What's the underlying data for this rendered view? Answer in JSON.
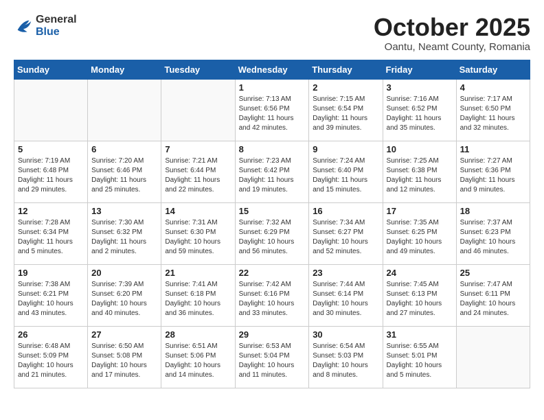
{
  "header": {
    "logo_general": "General",
    "logo_blue": "Blue",
    "month": "October 2025",
    "location": "Oantu, Neamt County, Romania"
  },
  "days_of_week": [
    "Sunday",
    "Monday",
    "Tuesday",
    "Wednesday",
    "Thursday",
    "Friday",
    "Saturday"
  ],
  "weeks": [
    [
      {
        "num": "",
        "info": ""
      },
      {
        "num": "",
        "info": ""
      },
      {
        "num": "",
        "info": ""
      },
      {
        "num": "1",
        "info": "Sunrise: 7:13 AM\nSunset: 6:56 PM\nDaylight: 11 hours\nand 42 minutes."
      },
      {
        "num": "2",
        "info": "Sunrise: 7:15 AM\nSunset: 6:54 PM\nDaylight: 11 hours\nand 39 minutes."
      },
      {
        "num": "3",
        "info": "Sunrise: 7:16 AM\nSunset: 6:52 PM\nDaylight: 11 hours\nand 35 minutes."
      },
      {
        "num": "4",
        "info": "Sunrise: 7:17 AM\nSunset: 6:50 PM\nDaylight: 11 hours\nand 32 minutes."
      }
    ],
    [
      {
        "num": "5",
        "info": "Sunrise: 7:19 AM\nSunset: 6:48 PM\nDaylight: 11 hours\nand 29 minutes."
      },
      {
        "num": "6",
        "info": "Sunrise: 7:20 AM\nSunset: 6:46 PM\nDaylight: 11 hours\nand 25 minutes."
      },
      {
        "num": "7",
        "info": "Sunrise: 7:21 AM\nSunset: 6:44 PM\nDaylight: 11 hours\nand 22 minutes."
      },
      {
        "num": "8",
        "info": "Sunrise: 7:23 AM\nSunset: 6:42 PM\nDaylight: 11 hours\nand 19 minutes."
      },
      {
        "num": "9",
        "info": "Sunrise: 7:24 AM\nSunset: 6:40 PM\nDaylight: 11 hours\nand 15 minutes."
      },
      {
        "num": "10",
        "info": "Sunrise: 7:25 AM\nSunset: 6:38 PM\nDaylight: 11 hours\nand 12 minutes."
      },
      {
        "num": "11",
        "info": "Sunrise: 7:27 AM\nSunset: 6:36 PM\nDaylight: 11 hours\nand 9 minutes."
      }
    ],
    [
      {
        "num": "12",
        "info": "Sunrise: 7:28 AM\nSunset: 6:34 PM\nDaylight: 11 hours\nand 5 minutes."
      },
      {
        "num": "13",
        "info": "Sunrise: 7:30 AM\nSunset: 6:32 PM\nDaylight: 11 hours\nand 2 minutes."
      },
      {
        "num": "14",
        "info": "Sunrise: 7:31 AM\nSunset: 6:30 PM\nDaylight: 10 hours\nand 59 minutes."
      },
      {
        "num": "15",
        "info": "Sunrise: 7:32 AM\nSunset: 6:29 PM\nDaylight: 10 hours\nand 56 minutes."
      },
      {
        "num": "16",
        "info": "Sunrise: 7:34 AM\nSunset: 6:27 PM\nDaylight: 10 hours\nand 52 minutes."
      },
      {
        "num": "17",
        "info": "Sunrise: 7:35 AM\nSunset: 6:25 PM\nDaylight: 10 hours\nand 49 minutes."
      },
      {
        "num": "18",
        "info": "Sunrise: 7:37 AM\nSunset: 6:23 PM\nDaylight: 10 hours\nand 46 minutes."
      }
    ],
    [
      {
        "num": "19",
        "info": "Sunrise: 7:38 AM\nSunset: 6:21 PM\nDaylight: 10 hours\nand 43 minutes."
      },
      {
        "num": "20",
        "info": "Sunrise: 7:39 AM\nSunset: 6:20 PM\nDaylight: 10 hours\nand 40 minutes."
      },
      {
        "num": "21",
        "info": "Sunrise: 7:41 AM\nSunset: 6:18 PM\nDaylight: 10 hours\nand 36 minutes."
      },
      {
        "num": "22",
        "info": "Sunrise: 7:42 AM\nSunset: 6:16 PM\nDaylight: 10 hours\nand 33 minutes."
      },
      {
        "num": "23",
        "info": "Sunrise: 7:44 AM\nSunset: 6:14 PM\nDaylight: 10 hours\nand 30 minutes."
      },
      {
        "num": "24",
        "info": "Sunrise: 7:45 AM\nSunset: 6:13 PM\nDaylight: 10 hours\nand 27 minutes."
      },
      {
        "num": "25",
        "info": "Sunrise: 7:47 AM\nSunset: 6:11 PM\nDaylight: 10 hours\nand 24 minutes."
      }
    ],
    [
      {
        "num": "26",
        "info": "Sunrise: 6:48 AM\nSunset: 5:09 PM\nDaylight: 10 hours\nand 21 minutes."
      },
      {
        "num": "27",
        "info": "Sunrise: 6:50 AM\nSunset: 5:08 PM\nDaylight: 10 hours\nand 17 minutes."
      },
      {
        "num": "28",
        "info": "Sunrise: 6:51 AM\nSunset: 5:06 PM\nDaylight: 10 hours\nand 14 minutes."
      },
      {
        "num": "29",
        "info": "Sunrise: 6:53 AM\nSunset: 5:04 PM\nDaylight: 10 hours\nand 11 minutes."
      },
      {
        "num": "30",
        "info": "Sunrise: 6:54 AM\nSunset: 5:03 PM\nDaylight: 10 hours\nand 8 minutes."
      },
      {
        "num": "31",
        "info": "Sunrise: 6:55 AM\nSunset: 5:01 PM\nDaylight: 10 hours\nand 5 minutes."
      },
      {
        "num": "",
        "info": ""
      }
    ]
  ]
}
